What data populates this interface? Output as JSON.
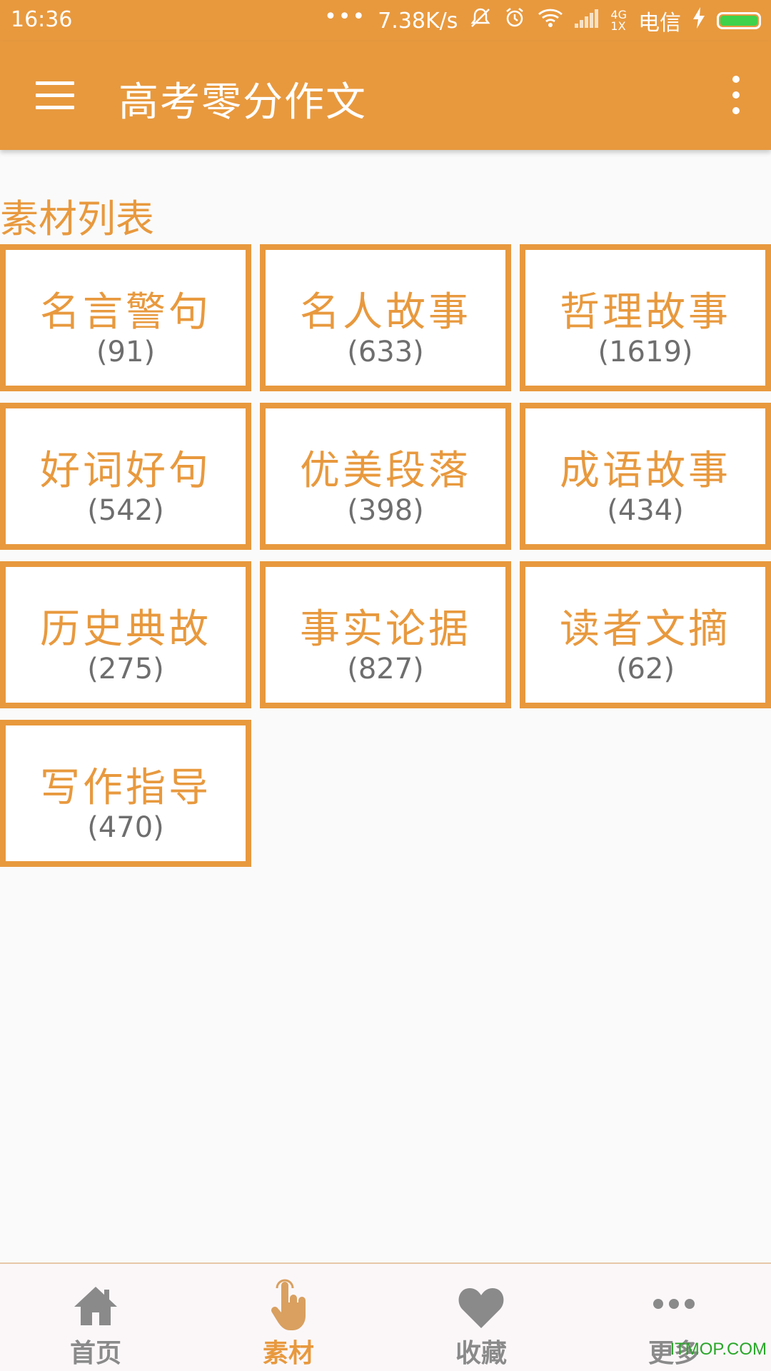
{
  "status_bar": {
    "time": "16:36",
    "more_dots": "•••",
    "net_speed": "7.38K/s",
    "network_type_top": "4G",
    "network_type_bottom": "1X",
    "carrier": "电信",
    "icons": [
      "mute-icon",
      "alarm-icon",
      "wifi-icon",
      "signal-icon",
      "charging-icon",
      "battery-icon"
    ],
    "battery_color": "#3fd24a"
  },
  "app_bar": {
    "title": "高考零分作文",
    "menu_icon": "hamburger-icon",
    "more_icon": "overflow-menu-icon",
    "color": "#e8993e"
  },
  "section": {
    "title": "素材列表"
  },
  "categories": [
    {
      "name": "名言警句",
      "count": "(91)"
    },
    {
      "name": "名人故事",
      "count": "(633)"
    },
    {
      "name": "哲理故事",
      "count": "(1619)"
    },
    {
      "name": "好词好句",
      "count": "(542)"
    },
    {
      "name": "优美段落",
      "count": "(398)"
    },
    {
      "name": "成语故事",
      "count": "(434)"
    },
    {
      "name": "历史典故",
      "count": "(275)"
    },
    {
      "name": "事实论据",
      "count": "(827)"
    },
    {
      "name": "读者文摘",
      "count": "(62)"
    },
    {
      "name": "写作指导",
      "count": "(470)"
    }
  ],
  "bottom_nav": {
    "items": [
      {
        "label": "首页",
        "icon": "home-icon"
      },
      {
        "label": "素材",
        "icon": "pointer-hand-icon",
        "active": true
      },
      {
        "label": "收藏",
        "icon": "heart-icon"
      },
      {
        "label": "更多",
        "icon": "more-dots-icon"
      }
    ],
    "active_color": "#e8993e",
    "inactive_color": "#8a8a8a"
  },
  "watermark": "ITMOP.COM"
}
